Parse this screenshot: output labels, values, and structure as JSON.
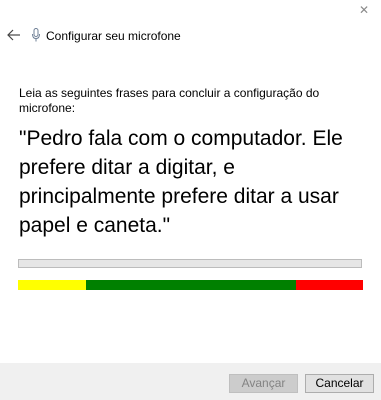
{
  "window": {
    "title": "Configurar seu microfone",
    "close_glyph": "✕",
    "close_icon": "close-icon",
    "back_icon": "back-arrow-icon",
    "mic_icon": "microphone-icon"
  },
  "main": {
    "instruction": "Leia as seguintes frases para concluir a configuração do microfone:",
    "phrase": "\"Pedro fala com o computador. Ele prefere ditar a digitar, e principalmente prefere ditar a usar papel e caneta.\""
  },
  "level_bar": {
    "value": 0,
    "track_color": "#e6e6e6"
  },
  "volume_meter": {
    "segments": [
      {
        "zone": "low",
        "color": "#ffff00",
        "fraction": 0.196
      },
      {
        "zone": "ok",
        "color": "#008000",
        "fraction": 0.609
      },
      {
        "zone": "high",
        "color": "#ff0000",
        "fraction": 0.195
      }
    ]
  },
  "footer": {
    "next_label": "Avançar",
    "next_enabled": false,
    "cancel_label": "Cancelar"
  }
}
